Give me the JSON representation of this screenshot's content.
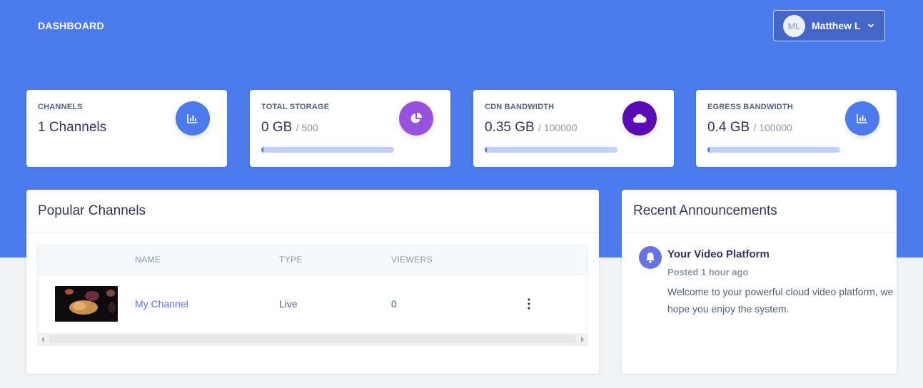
{
  "header": {
    "brand": "DASHBOARD",
    "user": {
      "initials": "ML",
      "name": "Matthew L"
    }
  },
  "stats": [
    {
      "title": "CHANNELS",
      "value": "1 Channels",
      "icon": "bar-chart-icon",
      "color": "#4b7bec"
    },
    {
      "title": "TOTAL STORAGE",
      "value": "0 GB",
      "max": "/ 500",
      "icon": "pie-chart-icon",
      "color": "#9b51e0",
      "progress": 0.0
    },
    {
      "title": "CDN BANDWIDTH",
      "value": "0.35 GB",
      "max": "/ 100000",
      "icon": "cloud-icon",
      "color": "#5b0bb5",
      "progress": 0.0
    },
    {
      "title": "EGRESS BANDWIDTH",
      "value": "0.4 GB",
      "max": "/ 100000",
      "icon": "bar-chart-icon",
      "color": "#4b7bec",
      "progress": 0.0
    }
  ],
  "popular": {
    "title": "Popular Channels",
    "columns": [
      "NAME",
      "TYPE",
      "VIEWERS"
    ],
    "rows": [
      {
        "name": "My Channel",
        "type": "Live",
        "viewers": "0"
      }
    ]
  },
  "announcements": {
    "title": "Recent Announcements",
    "items": [
      {
        "title": "Your Video Platform",
        "time": "Posted 1 hour ago",
        "text": "Welcome to your powerful cloud video platform, we hope you enjoy the system."
      }
    ]
  }
}
